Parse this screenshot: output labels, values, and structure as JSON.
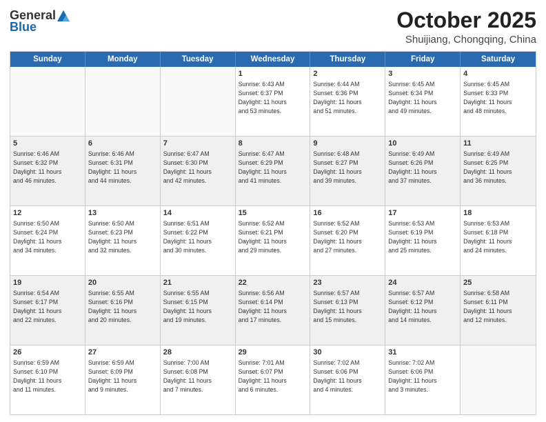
{
  "header": {
    "logo_general": "General",
    "logo_blue": "Blue",
    "month": "October 2025",
    "location": "Shuijiang, Chongqing, China"
  },
  "days_of_week": [
    "Sunday",
    "Monday",
    "Tuesday",
    "Wednesday",
    "Thursday",
    "Friday",
    "Saturday"
  ],
  "weeks": [
    [
      {
        "day": "",
        "text": ""
      },
      {
        "day": "",
        "text": ""
      },
      {
        "day": "",
        "text": ""
      },
      {
        "day": "1",
        "text": "Sunrise: 6:43 AM\nSunset: 6:37 PM\nDaylight: 11 hours\nand 53 minutes."
      },
      {
        "day": "2",
        "text": "Sunrise: 6:44 AM\nSunset: 6:36 PM\nDaylight: 11 hours\nand 51 minutes."
      },
      {
        "day": "3",
        "text": "Sunrise: 6:45 AM\nSunset: 6:34 PM\nDaylight: 11 hours\nand 49 minutes."
      },
      {
        "day": "4",
        "text": "Sunrise: 6:45 AM\nSunset: 6:33 PM\nDaylight: 11 hours\nand 48 minutes."
      }
    ],
    [
      {
        "day": "5",
        "text": "Sunrise: 6:46 AM\nSunset: 6:32 PM\nDaylight: 11 hours\nand 46 minutes."
      },
      {
        "day": "6",
        "text": "Sunrise: 6:46 AM\nSunset: 6:31 PM\nDaylight: 11 hours\nand 44 minutes."
      },
      {
        "day": "7",
        "text": "Sunrise: 6:47 AM\nSunset: 6:30 PM\nDaylight: 11 hours\nand 42 minutes."
      },
      {
        "day": "8",
        "text": "Sunrise: 6:47 AM\nSunset: 6:29 PM\nDaylight: 11 hours\nand 41 minutes."
      },
      {
        "day": "9",
        "text": "Sunrise: 6:48 AM\nSunset: 6:27 PM\nDaylight: 11 hours\nand 39 minutes."
      },
      {
        "day": "10",
        "text": "Sunrise: 6:49 AM\nSunset: 6:26 PM\nDaylight: 11 hours\nand 37 minutes."
      },
      {
        "day": "11",
        "text": "Sunrise: 6:49 AM\nSunset: 6:25 PM\nDaylight: 11 hours\nand 36 minutes."
      }
    ],
    [
      {
        "day": "12",
        "text": "Sunrise: 6:50 AM\nSunset: 6:24 PM\nDaylight: 11 hours\nand 34 minutes."
      },
      {
        "day": "13",
        "text": "Sunrise: 6:50 AM\nSunset: 6:23 PM\nDaylight: 11 hours\nand 32 minutes."
      },
      {
        "day": "14",
        "text": "Sunrise: 6:51 AM\nSunset: 6:22 PM\nDaylight: 11 hours\nand 30 minutes."
      },
      {
        "day": "15",
        "text": "Sunrise: 6:52 AM\nSunset: 6:21 PM\nDaylight: 11 hours\nand 29 minutes."
      },
      {
        "day": "16",
        "text": "Sunrise: 6:52 AM\nSunset: 6:20 PM\nDaylight: 11 hours\nand 27 minutes."
      },
      {
        "day": "17",
        "text": "Sunrise: 6:53 AM\nSunset: 6:19 PM\nDaylight: 11 hours\nand 25 minutes."
      },
      {
        "day": "18",
        "text": "Sunrise: 6:53 AM\nSunset: 6:18 PM\nDaylight: 11 hours\nand 24 minutes."
      }
    ],
    [
      {
        "day": "19",
        "text": "Sunrise: 6:54 AM\nSunset: 6:17 PM\nDaylight: 11 hours\nand 22 minutes."
      },
      {
        "day": "20",
        "text": "Sunrise: 6:55 AM\nSunset: 6:16 PM\nDaylight: 11 hours\nand 20 minutes."
      },
      {
        "day": "21",
        "text": "Sunrise: 6:55 AM\nSunset: 6:15 PM\nDaylight: 11 hours\nand 19 minutes."
      },
      {
        "day": "22",
        "text": "Sunrise: 6:56 AM\nSunset: 6:14 PM\nDaylight: 11 hours\nand 17 minutes."
      },
      {
        "day": "23",
        "text": "Sunrise: 6:57 AM\nSunset: 6:13 PM\nDaylight: 11 hours\nand 15 minutes."
      },
      {
        "day": "24",
        "text": "Sunrise: 6:57 AM\nSunset: 6:12 PM\nDaylight: 11 hours\nand 14 minutes."
      },
      {
        "day": "25",
        "text": "Sunrise: 6:58 AM\nSunset: 6:11 PM\nDaylight: 11 hours\nand 12 minutes."
      }
    ],
    [
      {
        "day": "26",
        "text": "Sunrise: 6:59 AM\nSunset: 6:10 PM\nDaylight: 11 hours\nand 11 minutes."
      },
      {
        "day": "27",
        "text": "Sunrise: 6:59 AM\nSunset: 6:09 PM\nDaylight: 11 hours\nand 9 minutes."
      },
      {
        "day": "28",
        "text": "Sunrise: 7:00 AM\nSunset: 6:08 PM\nDaylight: 11 hours\nand 7 minutes."
      },
      {
        "day": "29",
        "text": "Sunrise: 7:01 AM\nSunset: 6:07 PM\nDaylight: 11 hours\nand 6 minutes."
      },
      {
        "day": "30",
        "text": "Sunrise: 7:02 AM\nSunset: 6:06 PM\nDaylight: 11 hours\nand 4 minutes."
      },
      {
        "day": "31",
        "text": "Sunrise: 7:02 AM\nSunset: 6:06 PM\nDaylight: 11 hours\nand 3 minutes."
      },
      {
        "day": "",
        "text": ""
      }
    ]
  ]
}
